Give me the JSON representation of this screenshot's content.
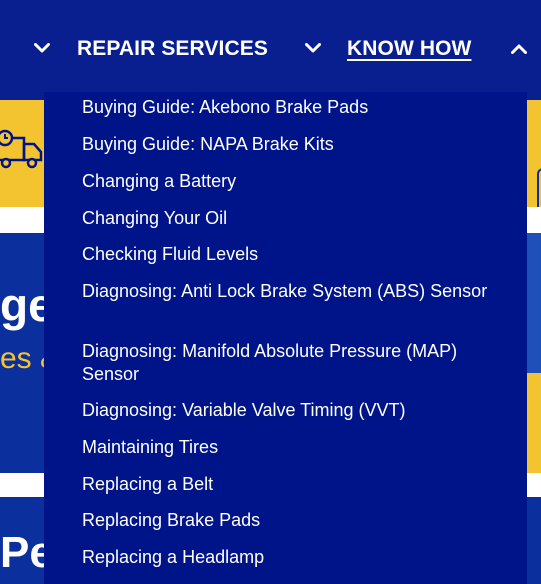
{
  "nav": {
    "repair_services": "REPAIR SERVICES",
    "know_how": "KNOW HOW"
  },
  "promo": {
    "headline_fragment": "ge",
    "subline_fragment": "es &",
    "bottom_fragment": "Pe"
  },
  "dropdown": {
    "items": [
      "Buying Guide: Akebono Brake Pads",
      "Buying Guide: NAPA Brake Kits",
      "Changing a Battery",
      "Changing Your Oil",
      "Checking Fluid Levels",
      "Diagnosing: Anti Lock Brake System (ABS) Sensor",
      "Diagnosing: Manifold Absolute Pressure (MAP) Sensor",
      "Diagnosing: Variable Valve Timing (VVT)",
      "Maintaining Tires",
      "Replacing a Belt",
      "Replacing Brake Pads",
      "Replacing a Headlamp"
    ]
  },
  "colors": {
    "nav_bg": "#0a1f8f",
    "dropdown_bg": "#00148a",
    "accent_yellow": "#f4c430",
    "text": "#ffffff"
  },
  "icons": {
    "chevron_down": "chevron-down-icon",
    "chevron_up": "chevron-up-icon",
    "truck": "truck-icon"
  }
}
